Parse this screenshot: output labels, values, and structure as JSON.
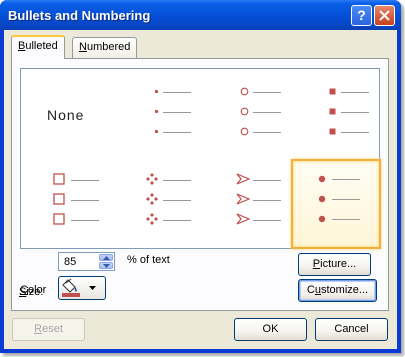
{
  "window": {
    "title": "Bullets and Numbering"
  },
  "titlebar": {
    "help_label": "?"
  },
  "tabs": [
    {
      "label": "Bulleted",
      "mnemonic": "B",
      "rest": "ulleted"
    },
    {
      "label": "Numbered",
      "mnemonic": "N",
      "rest": "umbered"
    }
  ],
  "gallery": {
    "none_label": "None",
    "bullet_color": "#c0504d",
    "styles": [
      "none",
      "small-dot",
      "hollow-circle",
      "filled-square",
      "hollow-square",
      "four-diamond",
      "arrowhead",
      "filled-circle"
    ],
    "selected_style": "filled-circle"
  },
  "size": {
    "label": "Size:",
    "mnemonic": "S",
    "rest": "ize:",
    "value": "85",
    "unit": "% of text"
  },
  "color": {
    "label": "Color",
    "mnemonic": "C",
    "rest": "olor",
    "swatch": "#c0504d"
  },
  "buttons": {
    "picture": {
      "label": "Picture...",
      "mnemonic": "P",
      "rest": "icture..."
    },
    "customize": {
      "label": "Customize...",
      "mnemonic": "u",
      "pre": "C",
      "rest": "stomize..."
    },
    "reset": {
      "label": "Reset",
      "mnemonic": "R",
      "rest": "eset"
    },
    "ok": {
      "label": "OK"
    },
    "cancel": {
      "label": "Cancel"
    }
  }
}
